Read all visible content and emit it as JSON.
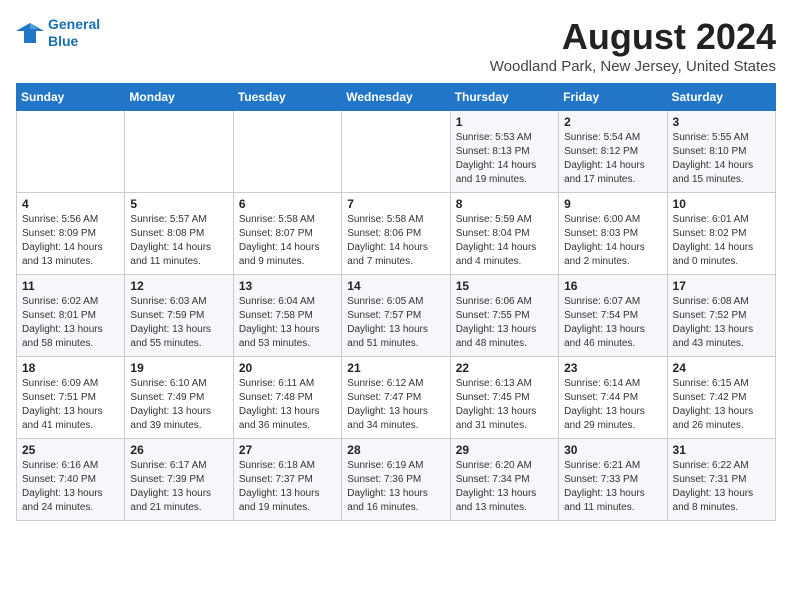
{
  "header": {
    "logo_line1": "General",
    "logo_line2": "Blue",
    "title": "August 2024",
    "subtitle": "Woodland Park, New Jersey, United States"
  },
  "weekdays": [
    "Sunday",
    "Monday",
    "Tuesday",
    "Wednesday",
    "Thursday",
    "Friday",
    "Saturday"
  ],
  "weeks": [
    [
      {
        "day": "",
        "text": ""
      },
      {
        "day": "",
        "text": ""
      },
      {
        "day": "",
        "text": ""
      },
      {
        "day": "",
        "text": ""
      },
      {
        "day": "1",
        "text": "Sunrise: 5:53 AM\nSunset: 8:13 PM\nDaylight: 14 hours\nand 19 minutes."
      },
      {
        "day": "2",
        "text": "Sunrise: 5:54 AM\nSunset: 8:12 PM\nDaylight: 14 hours\nand 17 minutes."
      },
      {
        "day": "3",
        "text": "Sunrise: 5:55 AM\nSunset: 8:10 PM\nDaylight: 14 hours\nand 15 minutes."
      }
    ],
    [
      {
        "day": "4",
        "text": "Sunrise: 5:56 AM\nSunset: 8:09 PM\nDaylight: 14 hours\nand 13 minutes."
      },
      {
        "day": "5",
        "text": "Sunrise: 5:57 AM\nSunset: 8:08 PM\nDaylight: 14 hours\nand 11 minutes."
      },
      {
        "day": "6",
        "text": "Sunrise: 5:58 AM\nSunset: 8:07 PM\nDaylight: 14 hours\nand 9 minutes."
      },
      {
        "day": "7",
        "text": "Sunrise: 5:58 AM\nSunset: 8:06 PM\nDaylight: 14 hours\nand 7 minutes."
      },
      {
        "day": "8",
        "text": "Sunrise: 5:59 AM\nSunset: 8:04 PM\nDaylight: 14 hours\nand 4 minutes."
      },
      {
        "day": "9",
        "text": "Sunrise: 6:00 AM\nSunset: 8:03 PM\nDaylight: 14 hours\nand 2 minutes."
      },
      {
        "day": "10",
        "text": "Sunrise: 6:01 AM\nSunset: 8:02 PM\nDaylight: 14 hours\nand 0 minutes."
      }
    ],
    [
      {
        "day": "11",
        "text": "Sunrise: 6:02 AM\nSunset: 8:01 PM\nDaylight: 13 hours\nand 58 minutes."
      },
      {
        "day": "12",
        "text": "Sunrise: 6:03 AM\nSunset: 7:59 PM\nDaylight: 13 hours\nand 55 minutes."
      },
      {
        "day": "13",
        "text": "Sunrise: 6:04 AM\nSunset: 7:58 PM\nDaylight: 13 hours\nand 53 minutes."
      },
      {
        "day": "14",
        "text": "Sunrise: 6:05 AM\nSunset: 7:57 PM\nDaylight: 13 hours\nand 51 minutes."
      },
      {
        "day": "15",
        "text": "Sunrise: 6:06 AM\nSunset: 7:55 PM\nDaylight: 13 hours\nand 48 minutes."
      },
      {
        "day": "16",
        "text": "Sunrise: 6:07 AM\nSunset: 7:54 PM\nDaylight: 13 hours\nand 46 minutes."
      },
      {
        "day": "17",
        "text": "Sunrise: 6:08 AM\nSunset: 7:52 PM\nDaylight: 13 hours\nand 43 minutes."
      }
    ],
    [
      {
        "day": "18",
        "text": "Sunrise: 6:09 AM\nSunset: 7:51 PM\nDaylight: 13 hours\nand 41 minutes."
      },
      {
        "day": "19",
        "text": "Sunrise: 6:10 AM\nSunset: 7:49 PM\nDaylight: 13 hours\nand 39 minutes."
      },
      {
        "day": "20",
        "text": "Sunrise: 6:11 AM\nSunset: 7:48 PM\nDaylight: 13 hours\nand 36 minutes."
      },
      {
        "day": "21",
        "text": "Sunrise: 6:12 AM\nSunset: 7:47 PM\nDaylight: 13 hours\nand 34 minutes."
      },
      {
        "day": "22",
        "text": "Sunrise: 6:13 AM\nSunset: 7:45 PM\nDaylight: 13 hours\nand 31 minutes."
      },
      {
        "day": "23",
        "text": "Sunrise: 6:14 AM\nSunset: 7:44 PM\nDaylight: 13 hours\nand 29 minutes."
      },
      {
        "day": "24",
        "text": "Sunrise: 6:15 AM\nSunset: 7:42 PM\nDaylight: 13 hours\nand 26 minutes."
      }
    ],
    [
      {
        "day": "25",
        "text": "Sunrise: 6:16 AM\nSunset: 7:40 PM\nDaylight: 13 hours\nand 24 minutes."
      },
      {
        "day": "26",
        "text": "Sunrise: 6:17 AM\nSunset: 7:39 PM\nDaylight: 13 hours\nand 21 minutes."
      },
      {
        "day": "27",
        "text": "Sunrise: 6:18 AM\nSunset: 7:37 PM\nDaylight: 13 hours\nand 19 minutes."
      },
      {
        "day": "28",
        "text": "Sunrise: 6:19 AM\nSunset: 7:36 PM\nDaylight: 13 hours\nand 16 minutes."
      },
      {
        "day": "29",
        "text": "Sunrise: 6:20 AM\nSunset: 7:34 PM\nDaylight: 13 hours\nand 13 minutes."
      },
      {
        "day": "30",
        "text": "Sunrise: 6:21 AM\nSunset: 7:33 PM\nDaylight: 13 hours\nand 11 minutes."
      },
      {
        "day": "31",
        "text": "Sunrise: 6:22 AM\nSunset: 7:31 PM\nDaylight: 13 hours\nand 8 minutes."
      }
    ]
  ]
}
